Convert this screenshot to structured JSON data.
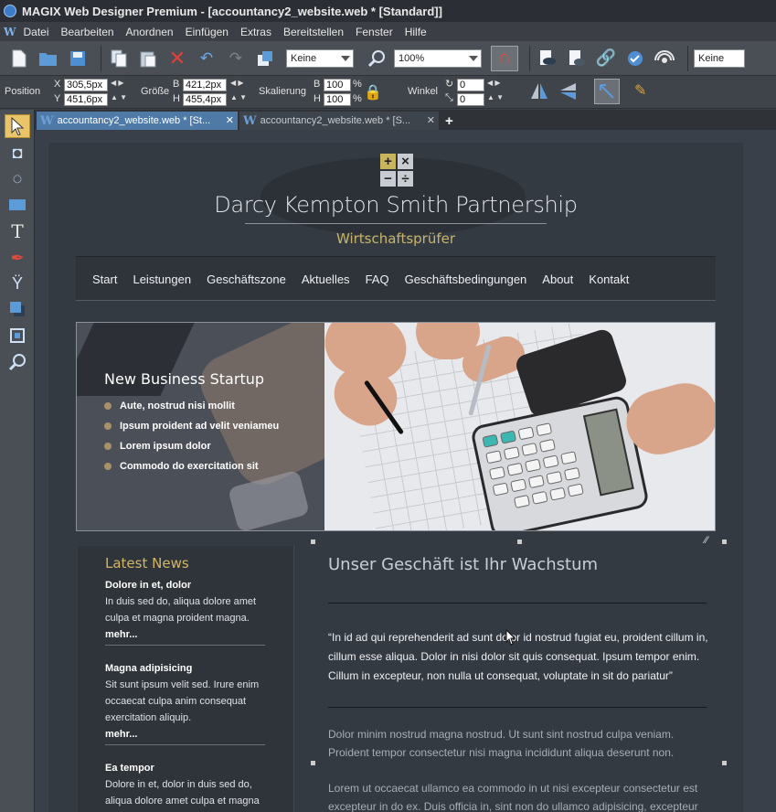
{
  "window": {
    "title": "MAGIX Web Designer Premium - [accountancy2_website.web * [Standard]]"
  },
  "menu": {
    "logo": "W",
    "items": [
      "Datei",
      "Bearbeiten",
      "Anordnen",
      "Einfügen",
      "Extras",
      "Bereitstellen",
      "Fenster",
      "Hilfe"
    ]
  },
  "toolbar": {
    "fill_combo": "Keine",
    "zoom_combo": "100%",
    "outline_combo": "Keine"
  },
  "props": {
    "position_label": "Position",
    "x_label": "X",
    "x_value": "305,5px",
    "y_label": "Y",
    "y_value": "451,6px",
    "size_label": "Größe",
    "b_label": "B",
    "b_value": "421,2px",
    "h_label": "H",
    "h_value": "455,4px",
    "scale_label": "Skalierung",
    "scale_b_label": "B",
    "scale_b_value": "100",
    "scale_h_label": "H",
    "scale_h_value": "100",
    "pct": "%",
    "angle_label": "Winkel",
    "angle1": "0",
    "angle2": "0"
  },
  "tabs": [
    {
      "label": "accountancy2_website.web * [St...",
      "close": "✕"
    },
    {
      "label": "accountancy2_website.web * [S...",
      "close": "✕"
    }
  ],
  "site": {
    "title": "Darcy Kempton Smith Partnership",
    "subtitle": "Wirtschaftsprüfer",
    "logo_symbols": [
      "+",
      "×",
      "−",
      "÷"
    ],
    "nav": [
      "Start",
      "Leistungen",
      "Geschäftszone",
      "Aktuelles",
      "FAQ",
      "Geschäftsbedingungen",
      "About",
      "Kontakt"
    ],
    "hero": {
      "title": "New Business Startup",
      "bullets": [
        "Aute, nostrud nisi mollit",
        "Ipsum proident ad velit veniameu",
        "Lorem ipsum dolor",
        "Commodo do exercitation sit"
      ]
    },
    "sidebar": {
      "heading": "Latest News",
      "items": [
        {
          "title": "Dolore in et, dolor",
          "text": "In duis sed do, aliqua dolore amet culpa et magna proident magna.",
          "more": "mehr..."
        },
        {
          "title": "Magna adipisicing",
          "text": "Sit sunt ipsum velit sed. Irure enim occaecat culpa anim consequat exercitation aliquip.",
          "more": "mehr..."
        },
        {
          "title": "Ea tempor",
          "text": "Dolore in et, dolor in duis sed do, aliqua dolore amet culpa et magna",
          "more": ""
        }
      ]
    },
    "main": {
      "heading": "Unser Geschäft ist Ihr Wachstum",
      "quote": "“In id ad qui reprehenderit ad sunt dolor id nostrud fugiat eu, proident cillum in, cillum esse aliqua. Dolor in nisi dolor sit quis consequat. Ipsum tempor enim. Cillum in excepteur, non nulla ut consequat, voluptate in sit do pariatur”",
      "para1": "Dolor minim nostrud magna nostrud. Ut sunt sint nostrud culpa veniam. Proident tempor consectetur nisi magna incididunt aliqua deserunt non.",
      "para2": "Lorem ut occaecat ullamco ea commodo in ut nisi excepteur consectetur est excepteur in do ex. Duis officia in, sint non do ullamco adipisicing, excepteur"
    }
  },
  "colors": {
    "accent_gold": "#c7b46a",
    "page_bg": "#343a42",
    "nav_bg": "#2f343b"
  }
}
